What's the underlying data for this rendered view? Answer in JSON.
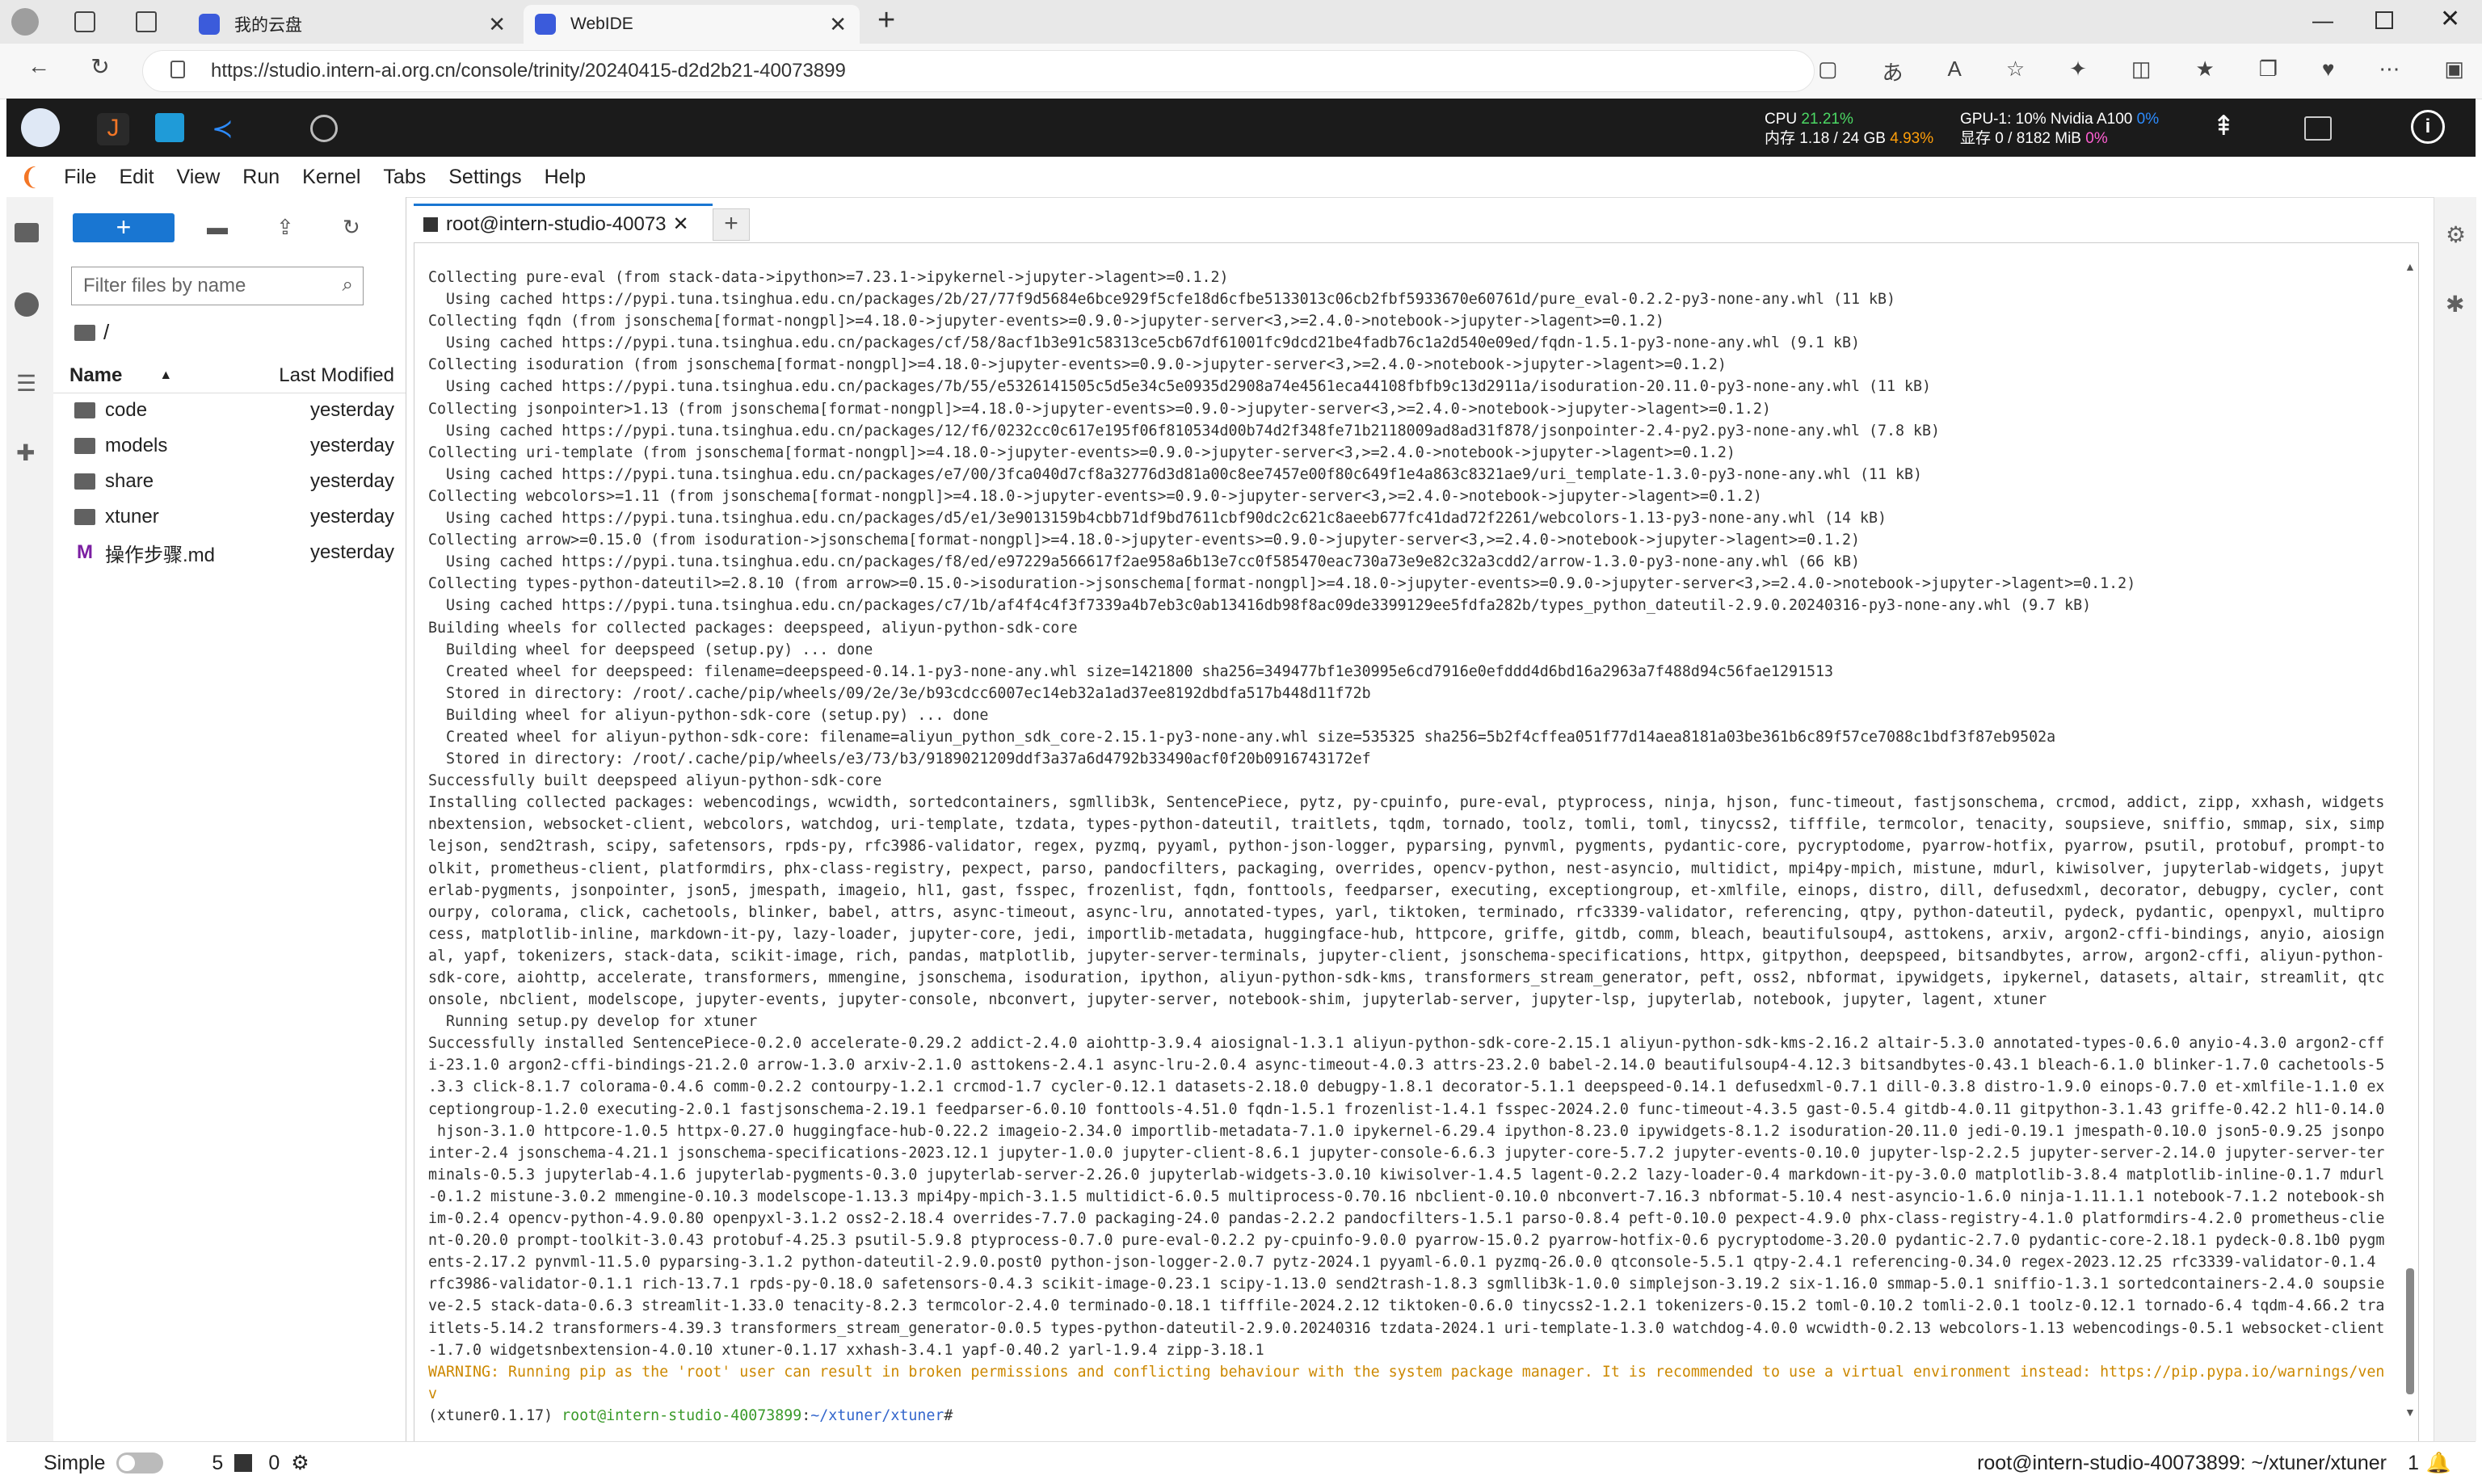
{
  "browser": {
    "tabs": [
      {
        "label": "我的云盘",
        "icon": "cloud-drive-icon"
      },
      {
        "label": "WebIDE",
        "icon": "webide-icon"
      }
    ],
    "url": "https://studio.intern-ai.org.cn/console/trinity/20240415-d2d2b21-40073899"
  },
  "ide_top": {
    "cpu_label": "CPU",
    "cpu_value": "21.21%",
    "mem_label": "内存",
    "mem_used": "1.18 / 24 GB",
    "mem_pct": "4.93%",
    "gpu_label": "GPU-1: 10% Nvidia A100",
    "gpu_pct": "0%",
    "vram_label": "显存",
    "vram_used": "0 / 8182 MiB",
    "vram_pct": "0%"
  },
  "menu": [
    "File",
    "Edit",
    "View",
    "Run",
    "Kernel",
    "Tabs",
    "Settings",
    "Help"
  ],
  "filebrowser": {
    "new_label": "+",
    "search_placeholder": "Filter files by name",
    "path": "/",
    "col_name": "Name",
    "col_modified": "Last Modified",
    "files": [
      {
        "name": "code",
        "type": "folder",
        "modified": "yesterday"
      },
      {
        "name": "models",
        "type": "folder",
        "modified": "yesterday"
      },
      {
        "name": "share",
        "type": "folder",
        "modified": "yesterday"
      },
      {
        "name": "xtuner",
        "type": "folder",
        "modified": "yesterday"
      },
      {
        "name": "操作步骤.md",
        "type": "markdown",
        "modified": "yesterday"
      }
    ]
  },
  "terminal": {
    "tab_label": "root@intern-studio-40073",
    "lines": [
      "Collecting pure-eval (from stack-data->ipython>=7.23.1->ipykernel->jupyter->lagent>=0.1.2)",
      "  Using cached https://pypi.tuna.tsinghua.edu.cn/packages/2b/27/77f9d5684e6bce929f5cfe18d6cfbe5133013c06cb2fbf5933670e60761d/pure_eval-0.2.2-py3-none-any.whl (11 kB)",
      "Collecting fqdn (from jsonschema[format-nongpl]>=4.18.0->jupyter-events>=0.9.0->jupyter-server<3,>=2.4.0->notebook->jupyter->lagent>=0.1.2)",
      "  Using cached https://pypi.tuna.tsinghua.edu.cn/packages/cf/58/8acf1b3e91c58313ce5cb67df61001fc9dcd21be4fadb76c1a2d540e09ed/fqdn-1.5.1-py3-none-any.whl (9.1 kB)",
      "Collecting isoduration (from jsonschema[format-nongpl]>=4.18.0->jupyter-events>=0.9.0->jupyter-server<3,>=2.4.0->notebook->jupyter->lagent>=0.1.2)",
      "  Using cached https://pypi.tuna.tsinghua.edu.cn/packages/7b/55/e5326141505c5d5e34c5e0935d2908a74e4561eca44108fbfb9c13d2911a/isoduration-20.11.0-py3-none-any.whl (11 kB)",
      "Collecting jsonpointer>1.13 (from jsonschema[format-nongpl]>=4.18.0->jupyter-events>=0.9.0->jupyter-server<3,>=2.4.0->notebook->jupyter->lagent>=0.1.2)",
      "  Using cached https://pypi.tuna.tsinghua.edu.cn/packages/12/f6/0232cc0c617e195f06f810534d00b74d2f348fe71b2118009ad8ad31f878/jsonpointer-2.4-py2.py3-none-any.whl (7.8 kB)",
      "Collecting uri-template (from jsonschema[format-nongpl]>=4.18.0->jupyter-events>=0.9.0->jupyter-server<3,>=2.4.0->notebook->jupyter->lagent>=0.1.2)",
      "  Using cached https://pypi.tuna.tsinghua.edu.cn/packages/e7/00/3fca040d7cf8a32776d3d81a00c8ee7457e00f80c649f1e4a863c8321ae9/uri_template-1.3.0-py3-none-any.whl (11 kB)",
      "Collecting webcolors>=1.11 (from jsonschema[format-nongpl]>=4.18.0->jupyter-events>=0.9.0->jupyter-server<3,>=2.4.0->notebook->jupyter->lagent>=0.1.2)",
      "  Using cached https://pypi.tuna.tsinghua.edu.cn/packages/d5/e1/3e9013159b4cbb71df9bd7611cbf90dc2c621c8aeeb677fc41dad72f2261/webcolors-1.13-py3-none-any.whl (14 kB)",
      "Collecting arrow>=0.15.0 (from isoduration->jsonschema[format-nongpl]>=4.18.0->jupyter-events>=0.9.0->jupyter-server<3,>=2.4.0->notebook->jupyter->lagent>=0.1.2)",
      "  Using cached https://pypi.tuna.tsinghua.edu.cn/packages/f8/ed/e97229a566617f2ae958a6b13e7cc0f585470eac730a73e9e82c32a3cdd2/arrow-1.3.0-py3-none-any.whl (66 kB)",
      "Collecting types-python-dateutil>=2.8.10 (from arrow>=0.15.0->isoduration->jsonschema[format-nongpl]>=4.18.0->jupyter-events>=0.9.0->jupyter-server<3,>=2.4.0->notebook->jupyter->lagent>=0.1.2)",
      "  Using cached https://pypi.tuna.tsinghua.edu.cn/packages/c7/1b/af4f4c4f3f7339a4b7eb3c0ab13416db98f8ac09de3399129ee5fdfa282b/types_python_dateutil-2.9.0.20240316-py3-none-any.whl (9.7 kB)",
      "Building wheels for collected packages: deepspeed, aliyun-python-sdk-core",
      "  Building wheel for deepspeed (setup.py) ... done",
      "  Created wheel for deepspeed: filename=deepspeed-0.14.1-py3-none-any.whl size=1421800 sha256=349477bf1e30995e6cd7916e0efddd4d6bd16a2963a7f488d94c56fae1291513",
      "  Stored in directory: /root/.cache/pip/wheels/09/2e/3e/b93cdcc6007ec14eb32a1ad37ee8192dbdfa517b448d11f72b",
      "  Building wheel for aliyun-python-sdk-core (setup.py) ... done",
      "  Created wheel for aliyun-python-sdk-core: filename=aliyun_python_sdk_core-2.15.1-py3-none-any.whl size=535325 sha256=5b2f4cffea051f77d14aea8181a03be361b6c89f57ce7088c1bdf3f87eb9502a",
      "  Stored in directory: /root/.cache/pip/wheels/e3/73/b3/9189021209ddf3a37a6d4792b33490acf0f20b0916743172ef",
      "Successfully built deepspeed aliyun-python-sdk-core",
      "Installing collected packages: webencodings, wcwidth, sortedcontainers, sgmllib3k, SentencePiece, pytz, py-cpuinfo, pure-eval, ptyprocess, ninja, hjson, func-timeout, fastjsonschema, crcmod, addict, zipp, xxhash, widgets",
      "nbextension, websocket-client, webcolors, watchdog, uri-template, tzdata, types-python-dateutil, traitlets, tqdm, tornado, toolz, tomli, toml, tinycss2, tifffile, termcolor, tenacity, soupsieve, sniffio, smmap, six, simp",
      "lejson, send2trash, scipy, safetensors, rpds-py, rfc3986-validator, regex, pyzmq, pyyaml, python-json-logger, pyparsing, pynvml, pygments, pydantic-core, pycryptodome, pyarrow-hotfix, pyarrow, psutil, protobuf, prompt-to",
      "olkit, prometheus-client, platformdirs, phx-class-registry, pexpect, parso, pandocfilters, packaging, overrides, opencv-python, nest-asyncio, multidict, mpi4py-mpich, mistune, mdurl, kiwisolver, jupyterlab-widgets, jupyt",
      "erlab-pygments, jsonpointer, json5, jmespath, imageio, hl1, gast, fsspec, frozenlist, fqdn, fonttools, feedparser, executing, exceptiongroup, et-xmlfile, einops, distro, dill, defusedxml, decorator, debugpy, cycler, cont",
      "ourpy, colorama, click, cachetools, blinker, babel, attrs, async-timeout, async-lru, annotated-types, yarl, tiktoken, terminado, rfc3339-validator, referencing, qtpy, python-dateutil, pydeck, pydantic, openpyxl, multipro",
      "cess, matplotlib-inline, markdown-it-py, lazy-loader, jupyter-core, jedi, importlib-metadata, huggingface-hub, httpcore, griffe, gitdb, comm, bleach, beautifulsoup4, asttokens, arxiv, argon2-cffi-bindings, anyio, aiosign",
      "al, yapf, tokenizers, stack-data, scikit-image, rich, pandas, matplotlib, jupyter-server-terminals, jupyter-client, jsonschema-specifications, httpx, gitpython, deepspeed, bitsandbytes, arrow, argon2-cffi, aliyun-python-",
      "sdk-core, aiohttp, accelerate, transformers, mmengine, jsonschema, isoduration, ipython, aliyun-python-sdk-kms, transformers_stream_generator, peft, oss2, nbformat, ipywidgets, ipykernel, datasets, altair, streamlit, qtc",
      "onsole, nbclient, modelscope, jupyter-events, jupyter-console, nbconvert, jupyter-server, notebook-shim, jupyterlab-server, jupyter-lsp, jupyterlab, notebook, jupyter, lagent, xtuner",
      "  Running setup.py develop for xtuner",
      "Successfully installed SentencePiece-0.2.0 accelerate-0.29.2 addict-2.4.0 aiohttp-3.9.4 aiosignal-1.3.1 aliyun-python-sdk-core-2.15.1 aliyun-python-sdk-kms-2.16.2 altair-5.3.0 annotated-types-0.6.0 anyio-4.3.0 argon2-cff",
      "i-23.1.0 argon2-cffi-bindings-21.2.0 arrow-1.3.0 arxiv-2.1.0 asttokens-2.4.1 async-lru-2.0.4 async-timeout-4.0.3 attrs-23.2.0 babel-2.14.0 beautifulsoup4-4.12.3 bitsandbytes-0.43.1 bleach-6.1.0 blinker-1.7.0 cachetools-5",
      ".3.3 click-8.1.7 colorama-0.4.6 comm-0.2.2 contourpy-1.2.1 crcmod-1.7 cycler-0.12.1 datasets-2.18.0 debugpy-1.8.1 decorator-5.1.1 deepspeed-0.14.1 defusedxml-0.7.1 dill-0.3.8 distro-1.9.0 einops-0.7.0 et-xmlfile-1.1.0 ex",
      "ceptiongroup-1.2.0 executing-2.0.1 fastjsonschema-2.19.1 feedparser-6.0.10 fonttools-4.51.0 fqdn-1.5.1 frozenlist-1.4.1 fsspec-2024.2.0 func-timeout-4.3.5 gast-0.5.4 gitdb-4.0.11 gitpython-3.1.43 griffe-0.42.2 hl1-0.14.0",
      " hjson-3.1.0 httpcore-1.0.5 httpx-0.27.0 huggingface-hub-0.22.2 imageio-2.34.0 importlib-metadata-7.1.0 ipykernel-6.29.4 ipython-8.23.0 ipywidgets-8.1.2 isoduration-20.11.0 jedi-0.19.1 jmespath-0.10.0 json5-0.9.25 jsonpo",
      "inter-2.4 jsonschema-4.21.1 jsonschema-specifications-2023.12.1 jupyter-1.0.0 jupyter-client-8.6.1 jupyter-console-6.6.3 jupyter-core-5.7.2 jupyter-events-0.10.0 jupyter-lsp-2.2.5 jupyter-server-2.14.0 jupyter-server-ter",
      "minals-0.5.3 jupyterlab-4.1.6 jupyterlab-pygments-0.3.0 jupyterlab-server-2.26.0 jupyterlab-widgets-3.0.10 kiwisolver-1.4.5 lagent-0.2.2 lazy-loader-0.4 markdown-it-py-3.0.0 matplotlib-3.8.4 matplotlib-inline-0.1.7 mdurl",
      "-0.1.2 mistune-3.0.2 mmengine-0.10.3 modelscope-1.13.3 mpi4py-mpich-3.1.5 multidict-6.0.5 multiprocess-0.70.16 nbclient-0.10.0 nbconvert-7.16.3 nbformat-5.10.4 nest-asyncio-1.6.0 ninja-1.11.1.1 notebook-7.1.2 notebook-sh",
      "im-0.2.4 opencv-python-4.9.0.80 openpyxl-3.1.2 oss2-2.18.4 overrides-7.7.0 packaging-24.0 pandas-2.2.2 pandocfilters-1.5.1 parso-0.8.4 peft-0.10.0 pexpect-4.9.0 phx-class-registry-4.1.0 platformdirs-4.2.0 prometheus-clie",
      "nt-0.20.0 prompt-toolkit-3.0.43 protobuf-4.25.3 psutil-5.9.8 ptyprocess-0.7.0 pure-eval-0.2.2 py-cpuinfo-9.0.0 pyarrow-15.0.2 pyarrow-hotfix-0.6 pycryptodome-3.20.0 pydantic-2.7.0 pydantic-core-2.18.1 pydeck-0.8.1b0 pygm",
      "ents-2.17.2 pynvml-11.5.0 pyparsing-3.1.2 python-dateutil-2.9.0.post0 python-json-logger-2.0.7 pytz-2024.1 pyyaml-6.0.1 pyzmq-26.0.0 qtconsole-5.5.1 qtpy-2.4.1 referencing-0.34.0 regex-2023.12.25 rfc3339-validator-0.1.4",
      "rfc3986-validator-0.1.1 rich-13.7.1 rpds-py-0.18.0 safetensors-0.4.3 scikit-image-0.23.1 scipy-1.13.0 send2trash-1.8.3 sgmllib3k-1.0.0 simplejson-3.19.2 six-1.16.0 smmap-5.0.1 sniffio-1.3.1 sortedcontainers-2.4.0 soupsie",
      "ve-2.5 stack-data-0.6.3 streamlit-1.33.0 tenacity-8.2.3 termcolor-2.4.0 terminado-0.18.1 tifffile-2024.2.12 tiktoken-0.6.0 tinycss2-1.2.1 tokenizers-0.15.2 toml-0.10.2 tomli-2.0.1 toolz-0.12.1 tornado-6.4 tqdm-4.66.2 tra",
      "itlets-5.14.2 transformers-4.39.3 transformers_stream_generator-0.0.5 types-python-dateutil-2.9.0.20240316 tzdata-2024.1 uri-template-1.3.0 watchdog-4.0.0 wcwidth-0.2.13 webcolors-1.13 webencodings-0.5.1 websocket-client",
      "-1.7.0 widgetsnbextension-4.0.10 xtuner-0.1.17 xxhash-3.4.1 yapf-0.40.2 yarl-1.9.4 zipp-3.18.1"
    ],
    "warning_lines": [
      "WARNING: Running pip as the 'root' user can result in broken permissions and conflicting behaviour with the system package manager. It is recommended to use a virtual environment instead: https://pip.pypa.io/warnings/ven",
      "v"
    ],
    "prompt_env": "(xtuner0.1.17) ",
    "prompt_host": "root@intern-studio-40073899",
    "prompt_sep": ":",
    "prompt_path": "~/xtuner/xtuner",
    "prompt_end": "#"
  },
  "statusbar": {
    "mode_label": "Simple",
    "count_terminals": "5",
    "count_kernels": "0",
    "location": "root@intern-studio-40073899: ~/xtuner/xtuner",
    "notifications": "1"
  }
}
